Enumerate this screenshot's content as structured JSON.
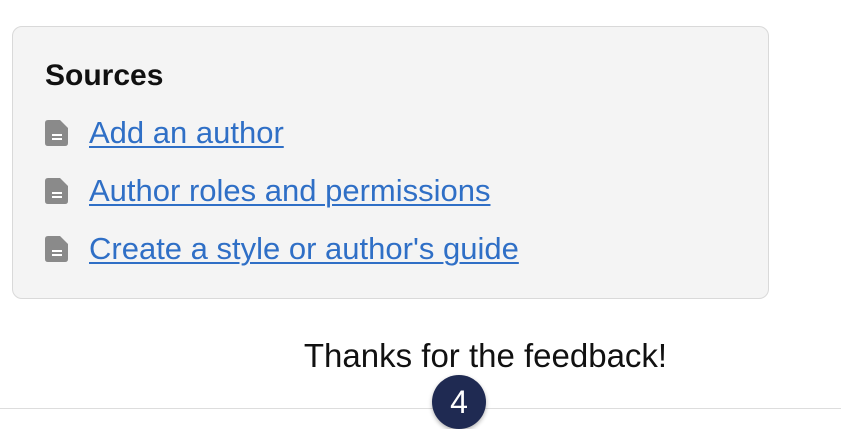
{
  "sources": {
    "title": "Sources",
    "items": [
      {
        "label": "Add an author",
        "icon": "document-icon"
      },
      {
        "label": "Author roles and permissions",
        "icon": "document-icon"
      },
      {
        "label": "Create a style or author's guide",
        "icon": "document-icon"
      }
    ]
  },
  "feedback": {
    "message": "Thanks for the feedback!"
  },
  "badge": {
    "count": "4"
  },
  "colors": {
    "link": "#2f6fc6",
    "icon": "#8a8a8a",
    "panel_bg": "#f4f4f4",
    "badge_bg": "#1f2a52"
  }
}
